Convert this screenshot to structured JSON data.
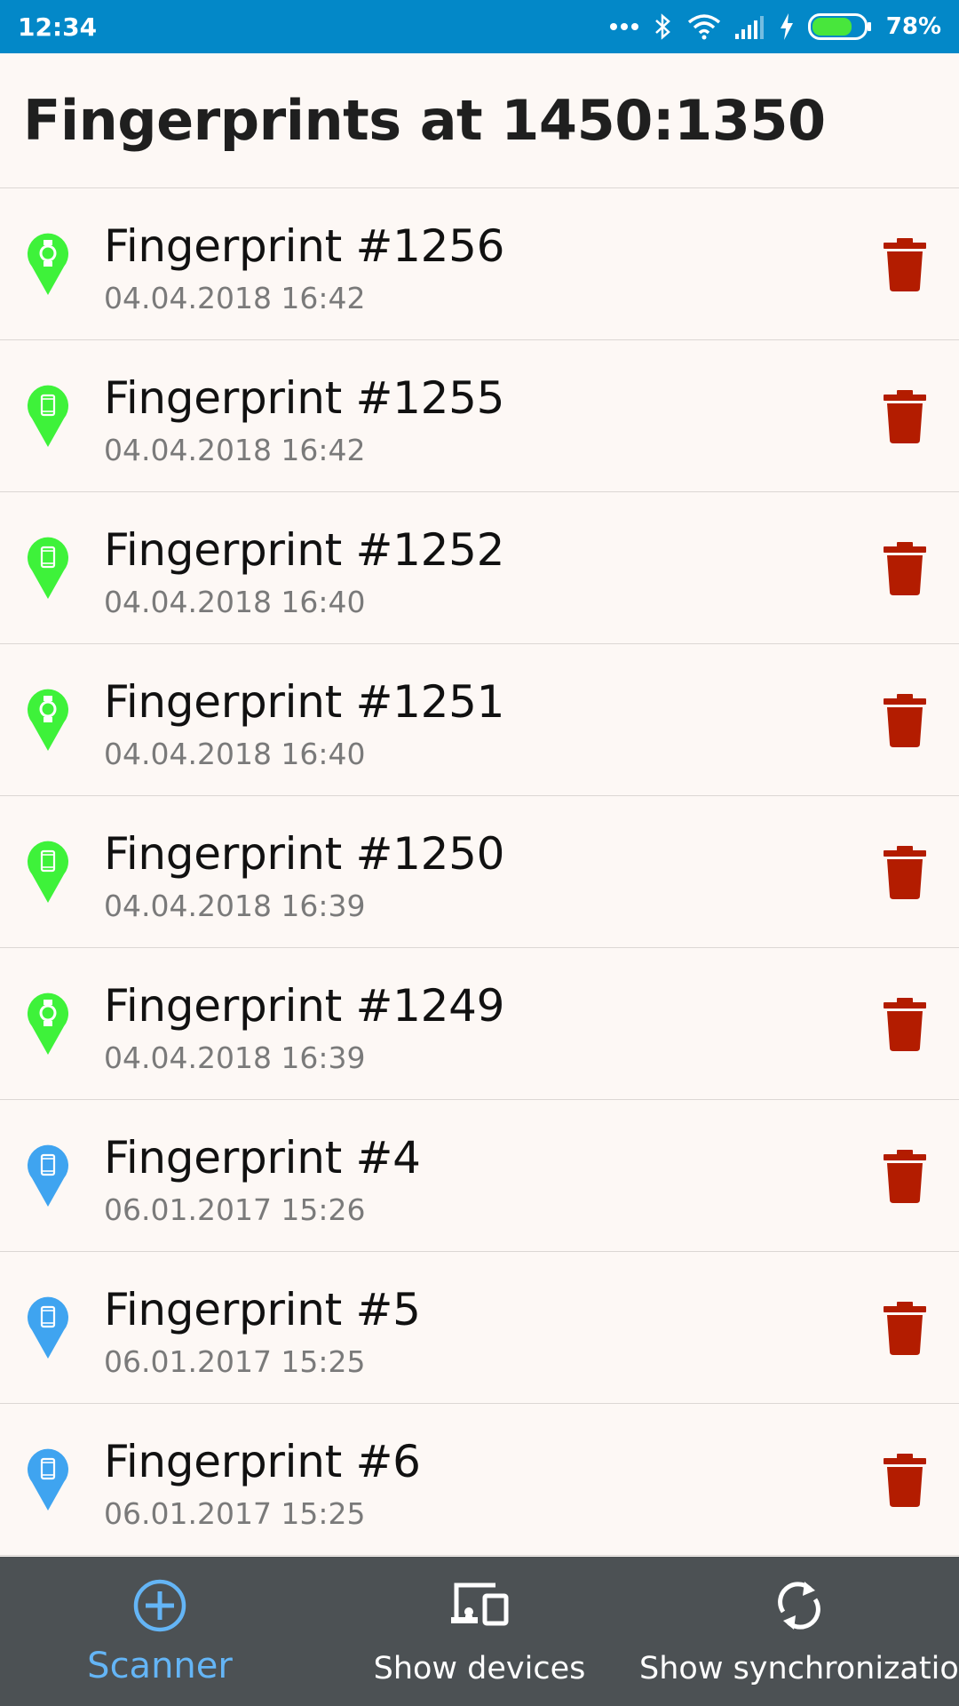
{
  "status_bar": {
    "time": "12:34",
    "battery": "78%",
    "icons": [
      "more-dots-icon",
      "bluetooth-icon",
      "wifi-icon",
      "signal-icon",
      "charging-icon",
      "battery-icon"
    ],
    "battery_level": 0.78,
    "color": "#0388c8"
  },
  "header": {
    "title": "Fingerprints at 1450:1350"
  },
  "list": {
    "items": [
      {
        "title": "Fingerprint #1256",
        "date": "04.04.2018 16:42",
        "device": "watch",
        "pin_color": "#3ef23a"
      },
      {
        "title": "Fingerprint #1255",
        "date": "04.04.2018 16:42",
        "device": "phone",
        "pin_color": "#3ef23a"
      },
      {
        "title": "Fingerprint #1252",
        "date": "04.04.2018 16:40",
        "device": "phone",
        "pin_color": "#3ef23a"
      },
      {
        "title": "Fingerprint #1251",
        "date": "04.04.2018 16:40",
        "device": "watch",
        "pin_color": "#3ef23a"
      },
      {
        "title": "Fingerprint #1250",
        "date": "04.04.2018 16:39",
        "device": "phone",
        "pin_color": "#3ef23a"
      },
      {
        "title": "Fingerprint #1249",
        "date": "04.04.2018 16:39",
        "device": "watch",
        "pin_color": "#3ef23a"
      },
      {
        "title": "Fingerprint #4",
        "date": "06.01.2017 15:26",
        "device": "phone",
        "pin_color": "#3fa4f0"
      },
      {
        "title": "Fingerprint #5",
        "date": "06.01.2017 15:25",
        "device": "phone",
        "pin_color": "#3fa4f0"
      },
      {
        "title": "Fingerprint #6",
        "date": "06.01.2017 15:25",
        "device": "phone",
        "pin_color": "#3fa4f0"
      }
    ],
    "delete_icon": "trash-icon",
    "delete_color": "#b31c00"
  },
  "bottom_nav": {
    "scanner": {
      "label": "Scanner",
      "icon": "add-circle-icon",
      "active": true,
      "color": "#64b5f6"
    },
    "devices": {
      "label": "Show devices",
      "icon": "devices-icon"
    },
    "sync": {
      "label": "Show synchronization",
      "icon": "sync-icon"
    },
    "background": "#4c5154"
  }
}
